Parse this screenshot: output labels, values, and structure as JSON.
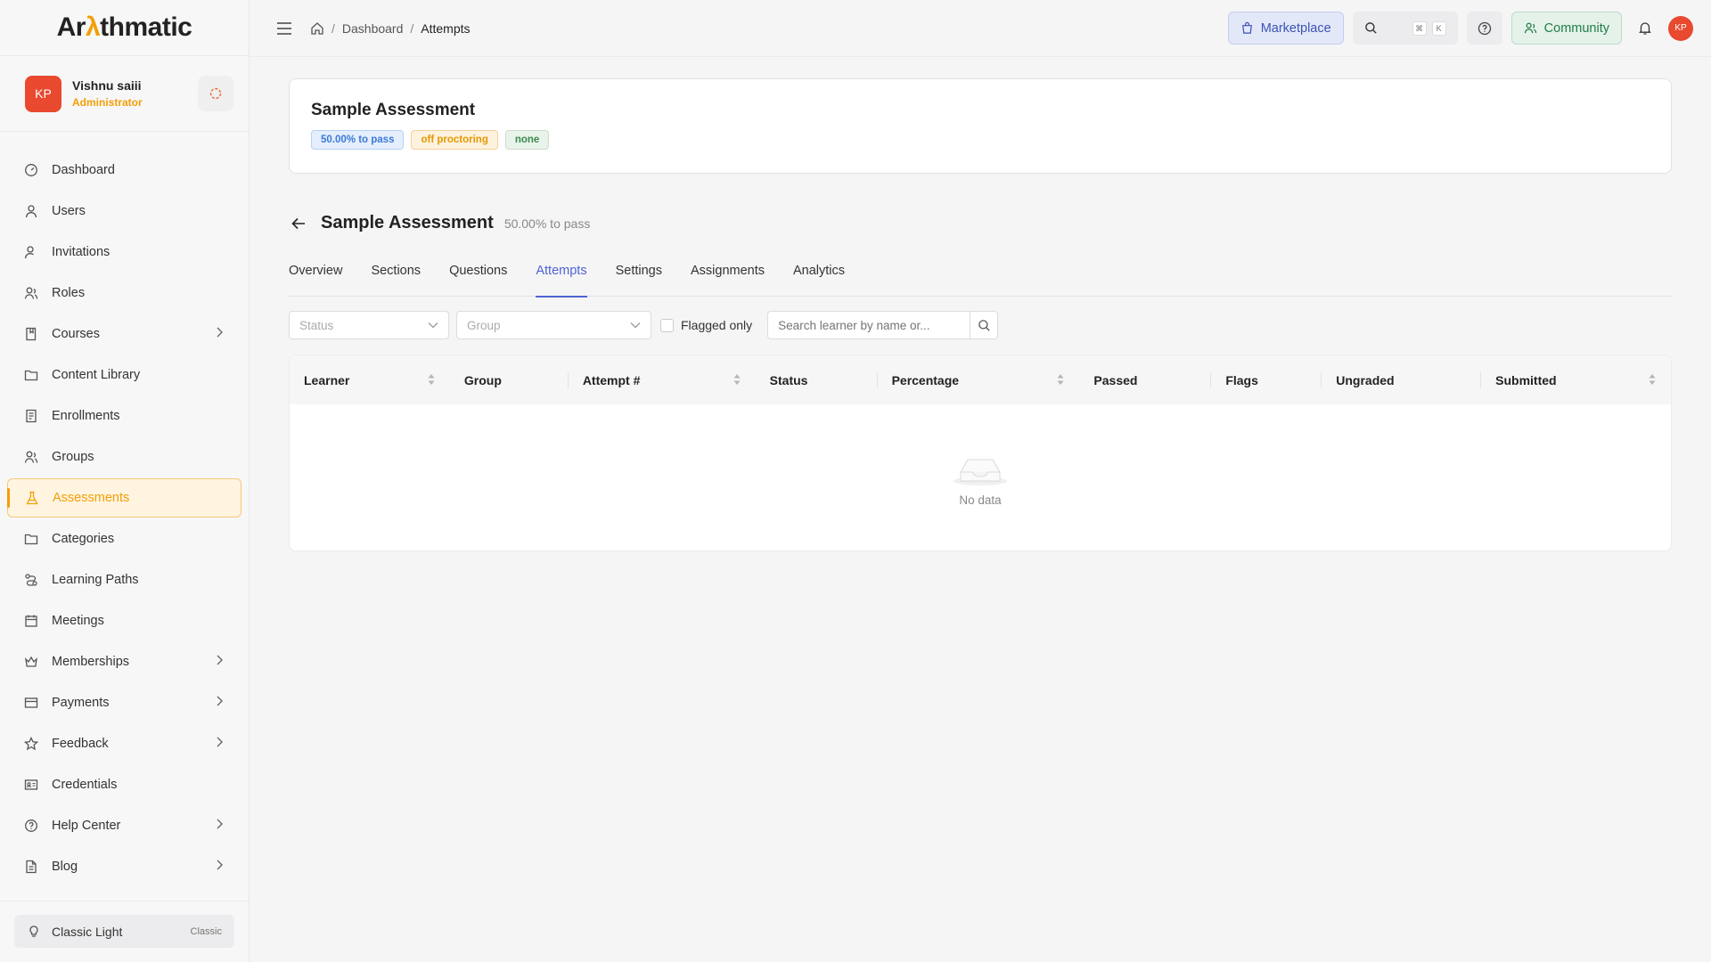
{
  "brand": {
    "logo_prefix": "Ar",
    "logo_accent": "λ",
    "logo_suffix": "thmatic",
    "accent_color": "#f29f05"
  },
  "user": {
    "initials": "KP",
    "name": "Vishnu saiii",
    "role": "Administrator"
  },
  "sidebar": {
    "items": [
      {
        "label": "Dashboard",
        "icon": "dashboard-icon"
      },
      {
        "label": "Users",
        "icon": "user-icon"
      },
      {
        "label": "Invitations",
        "icon": "user-plus-icon"
      },
      {
        "label": "Roles",
        "icon": "roles-icon"
      },
      {
        "label": "Courses",
        "icon": "book-icon",
        "expandable": true
      },
      {
        "label": "Content Library",
        "icon": "folder-icon"
      },
      {
        "label": "Enrollments",
        "icon": "list-icon"
      },
      {
        "label": "Groups",
        "icon": "group-icon"
      },
      {
        "label": "Assessments",
        "icon": "flask-icon",
        "active": true
      },
      {
        "label": "Categories",
        "icon": "folder-icon"
      },
      {
        "label": "Learning Paths",
        "icon": "path-icon"
      },
      {
        "label": "Meetings",
        "icon": "calendar-icon"
      },
      {
        "label": "Memberships",
        "icon": "crown-icon",
        "expandable": true
      },
      {
        "label": "Payments",
        "icon": "card-icon",
        "expandable": true
      },
      {
        "label": "Feedback",
        "icon": "star-icon",
        "expandable": true
      },
      {
        "label": "Credentials",
        "icon": "id-card-icon"
      },
      {
        "label": "Help Center",
        "icon": "help-icon",
        "expandable": true
      },
      {
        "label": "Blog",
        "icon": "document-icon",
        "expandable": true
      }
    ],
    "theme": {
      "label": "Classic Light",
      "tag": "Classic"
    }
  },
  "header": {
    "breadcrumb": [
      "Dashboard",
      "Attempts"
    ],
    "marketplace": "Marketplace",
    "search_keys": [
      "⌘",
      "K"
    ],
    "community": "Community",
    "avatar": "KP"
  },
  "summary": {
    "title": "Sample Assessment",
    "badges": [
      "50.00% to pass",
      "off proctoring",
      "none"
    ]
  },
  "page": {
    "title": "Sample Assessment",
    "subtitle": "50.00% to pass"
  },
  "tabs": [
    "Overview",
    "Sections",
    "Questions",
    "Attempts",
    "Settings",
    "Assignments",
    "Analytics"
  ],
  "active_tab": "Attempts",
  "filters": {
    "status_placeholder": "Status",
    "group_placeholder": "Group",
    "flagged_label": "Flagged only",
    "search_placeholder": "Search learner by name or..."
  },
  "table": {
    "columns": [
      "Learner",
      "Group",
      "Attempt #",
      "Status",
      "Percentage",
      "Passed",
      "Flags",
      "Ungraded",
      "Submitted"
    ],
    "empty_text": "No data"
  }
}
